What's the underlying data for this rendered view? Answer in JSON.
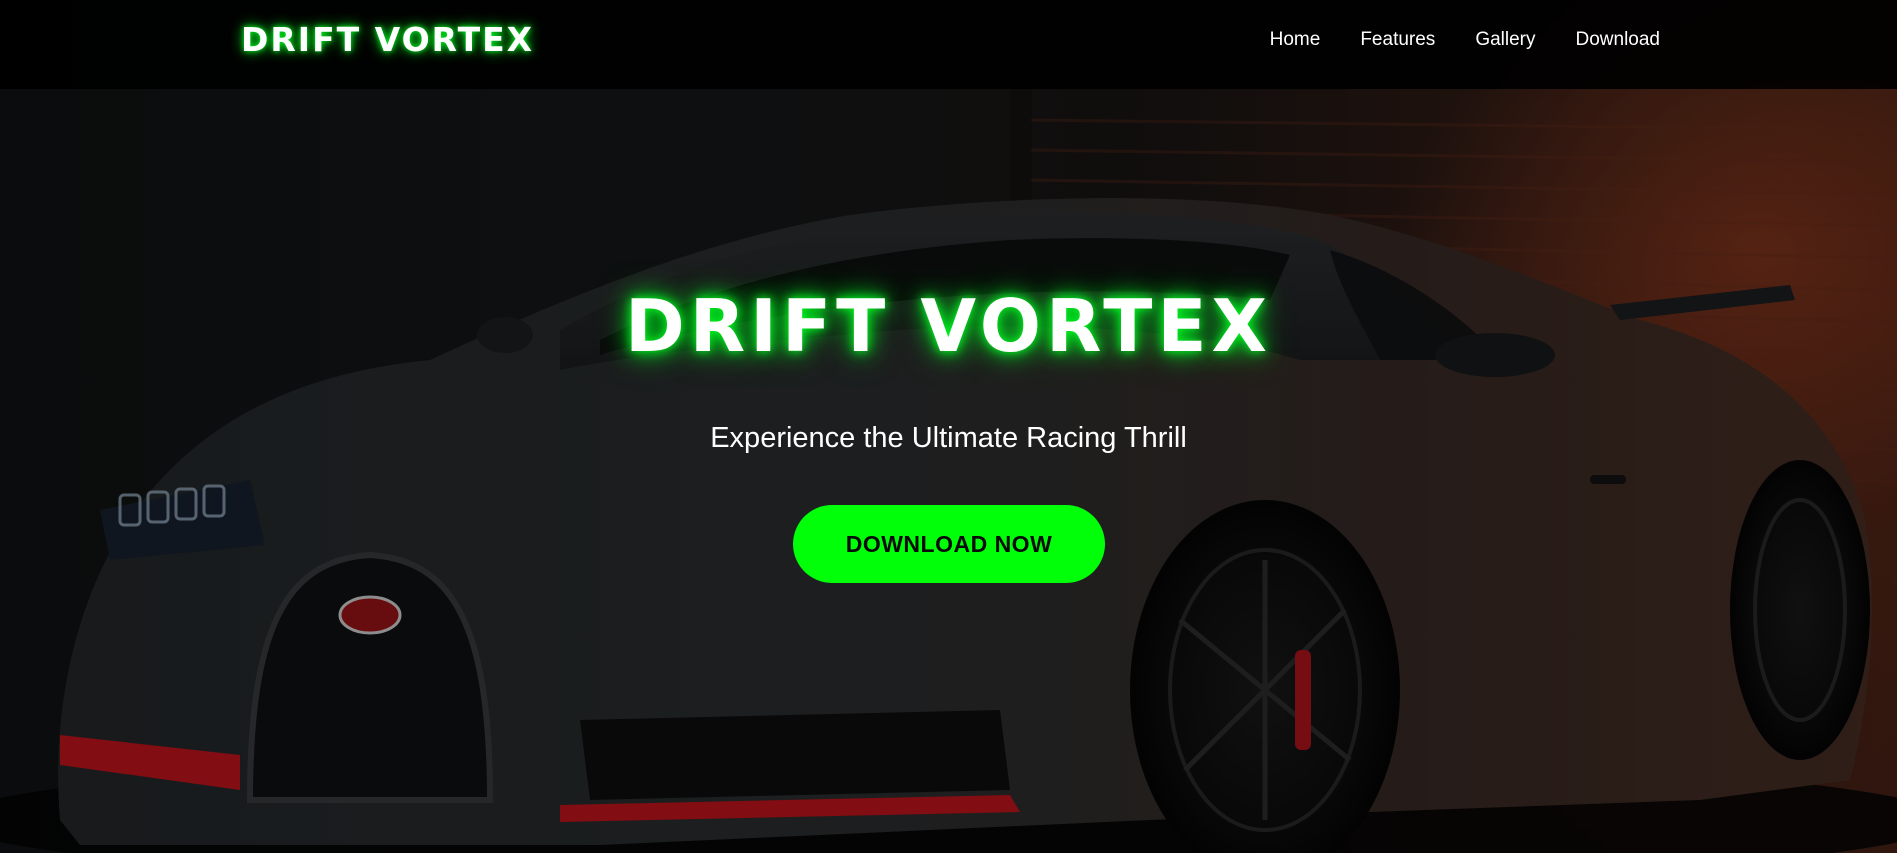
{
  "navbar": {
    "logo": "DRIFT VORTEX",
    "links": [
      "Home",
      "Features",
      "Gallery",
      "Download"
    ]
  },
  "hero": {
    "title": "DRIFT VORTEX",
    "subtitle": "Experience the Ultimate Racing Thrill",
    "cta_label": "DOWNLOAD NOW",
    "background_image": "car-photo"
  },
  "colors": {
    "accent": "#00ff08",
    "glow": "#00ff20",
    "navbar_bg": "#000000",
    "brake_red": "#c8141c"
  }
}
